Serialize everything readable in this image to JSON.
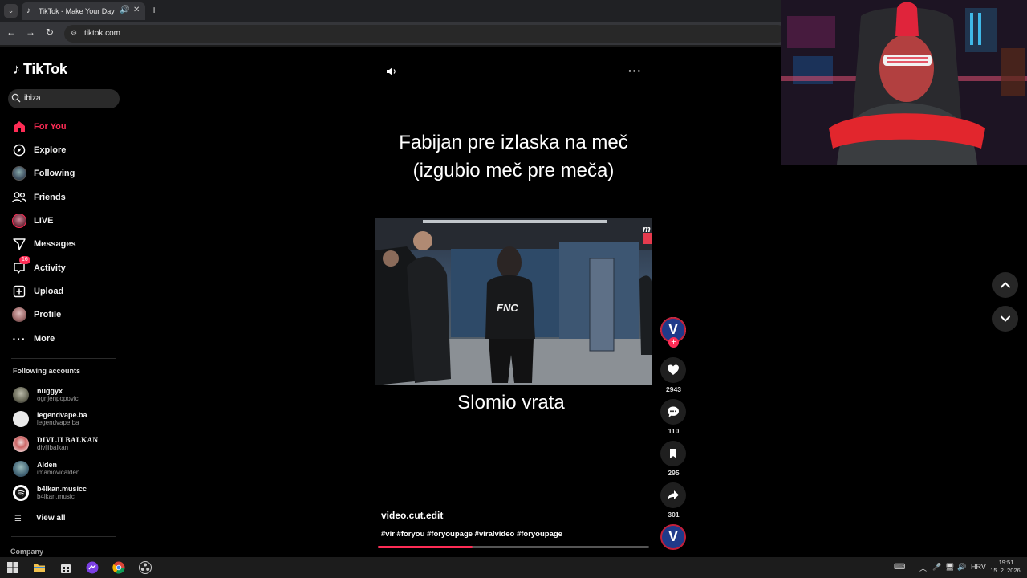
{
  "browser": {
    "tab_title": "TikTok - Make Your Day",
    "url": "tiktok.com",
    "new_tab": "+"
  },
  "sidebar": {
    "logo": "TikTok",
    "search_value": "ibiza",
    "nav": [
      {
        "label": "For You",
        "icon": "home-icon",
        "active": true
      },
      {
        "label": "Explore",
        "icon": "compass-icon"
      },
      {
        "label": "Following",
        "icon": "following-avatar-icon"
      },
      {
        "label": "Friends",
        "icon": "friends-icon"
      },
      {
        "label": "LIVE",
        "icon": "live-avatar-icon"
      },
      {
        "label": "Messages",
        "icon": "send-icon"
      },
      {
        "label": "Activity",
        "icon": "activity-icon",
        "badge": "16"
      },
      {
        "label": "Upload",
        "icon": "upload-icon"
      },
      {
        "label": "Profile",
        "icon": "profile-avatar-icon"
      },
      {
        "label": "More",
        "icon": "more-icon"
      }
    ],
    "following_title": "Following accounts",
    "accounts": [
      {
        "name": "nuggyx",
        "handle": "ognjenpopovic"
      },
      {
        "name": "legendvape.ba",
        "handle": "legendvape.ba"
      },
      {
        "name": "DIVLJI BALKAN",
        "handle": "divljibalkan"
      },
      {
        "name": "Alden",
        "handle": "imamovicalden"
      },
      {
        "name": "b4lkan.musicc",
        "handle": "b4lkan.music"
      }
    ],
    "view_all": "View all",
    "company": "Company"
  },
  "video": {
    "caption_line1": "Fabijan pre izlaska na meč",
    "caption_line2": "(izgubio meč pre meča)",
    "bottom_caption": "Slomio vrata",
    "frame_badge": "m",
    "shirt_text": "FNC",
    "author": "video.cut.edit",
    "hashtags": "#vir #foryou #foryoupage #viralvideo #foryoupage",
    "progress": 0.35,
    "likes": "2943",
    "comments": "110",
    "saves": "295",
    "shares": "301",
    "creator_initial": "V"
  },
  "taskbar": {
    "lang": "HRV",
    "time": "19:51",
    "date": "15. 2. 2026."
  }
}
